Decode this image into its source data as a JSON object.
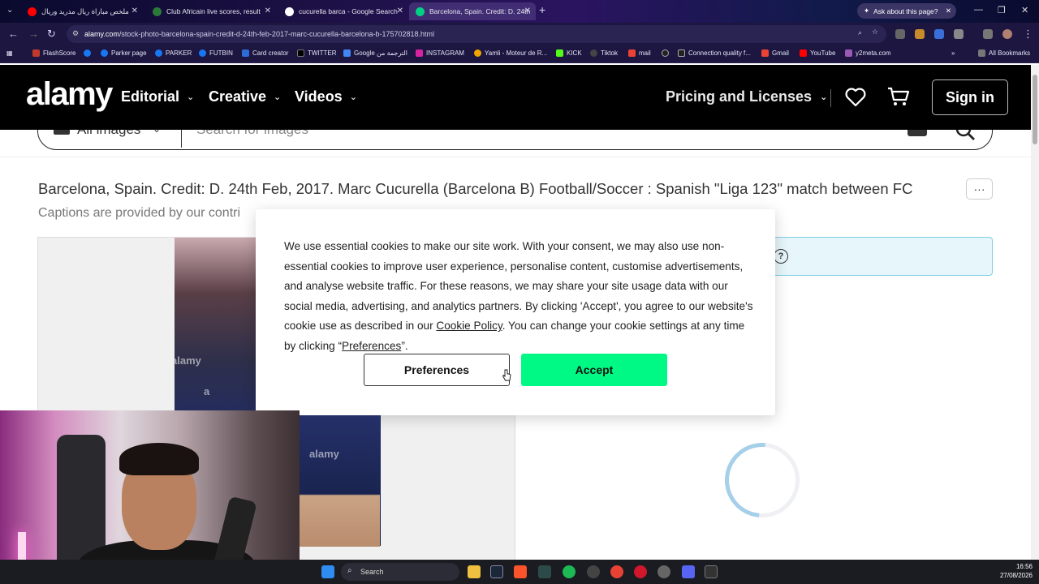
{
  "browser": {
    "tabs": [
      {
        "label": "ملخص مباراة ريال مدريد وريال",
        "color": "#ff0000"
      },
      {
        "label": "Club Africain live scores, result",
        "color": "#2b7a3a"
      },
      {
        "label": "cucurella barca - Google Search",
        "color": "#ffffff"
      },
      {
        "label": "Barcelona, Spain. Credit: D. 24th",
        "color": "#00d084",
        "active": true
      }
    ],
    "ask_button": "Ask about this page?",
    "url_domain": "alamy.com",
    "url_path": "/stock-photo-barcelona-spain-credit-d-24th-feb-2017-marc-cucurella-barcelona-b-175702818.html",
    "bookmarks": [
      {
        "label": "FlashScore",
        "color": "#c0392b"
      },
      {
        "label": "Parker page",
        "color": "#1877f2"
      },
      {
        "label": "PARKER",
        "color": "#1877f2"
      },
      {
        "label": "FUTBIN",
        "color": "#1877f2"
      },
      {
        "label": "Card creator",
        "color": "#2d6bd8"
      },
      {
        "label": "TWITTER",
        "color": "#000000"
      },
      {
        "label": "Google الترجمة من",
        "color": "#4285f4"
      },
      {
        "label": "INSTAGRAM",
        "color": "#d6249f"
      },
      {
        "label": "Yamli - Moteur de R...",
        "color": "#f0a500"
      },
      {
        "label": "KICK",
        "color": "#53fc18"
      },
      {
        "label": "Tiktok",
        "color": "#444444"
      },
      {
        "label": "mail",
        "color": "#ea4335"
      },
      {
        "label": "Connection quality f...",
        "color": "#222222"
      },
      {
        "label": "Gmail",
        "color": "#ea4335"
      },
      {
        "label": "YouTube",
        "color": "#ff0000"
      },
      {
        "label": "y2meta.com",
        "color": "#9b59b6"
      }
    ],
    "all_bookmarks": "All Bookmarks"
  },
  "header": {
    "logo": "alamy",
    "nav": [
      "Editorial",
      "Creative",
      "Videos"
    ],
    "pricing": "Pricing and Licenses",
    "signin": "Sign in"
  },
  "search": {
    "scope": "All images",
    "placeholder": "Search for images"
  },
  "main": {
    "title": "Barcelona, Spain. Credit: D. 24th Feb, 2017. Marc Cucurella (Barcelona B) Football/Soccer : Spanish \"Liga 123\" match between FC",
    "caption_note": "Captions are provided by our contri",
    "watermark": "alamy",
    "watermark_mark": "a"
  },
  "cookie": {
    "text_before": "We use essential cookies to make our site work. With your consent, we may also use non-essential cookies to improve user experience, personalise content, customise advertisements, and analyse website traffic. For these reasons, we may share your site usage data with our social media, advertising, and analytics partners. By clicking 'Accept', you agree to our website's cookie use as described in our ",
    "policy_link": "Cookie Policy",
    "text_middle": ". You can change your cookie settings at any time by clicking “",
    "preferences_link": "Preferences",
    "text_after": "”.",
    "preferences_button": "Preferences",
    "accept_button": "Accept"
  },
  "taskbar": {
    "search": "Search",
    "time": "16:56",
    "date": "27/08/2026"
  },
  "colors": {
    "accept": "#00f985",
    "header_bg": "#000000",
    "info_bg": "#e6f6fb"
  }
}
